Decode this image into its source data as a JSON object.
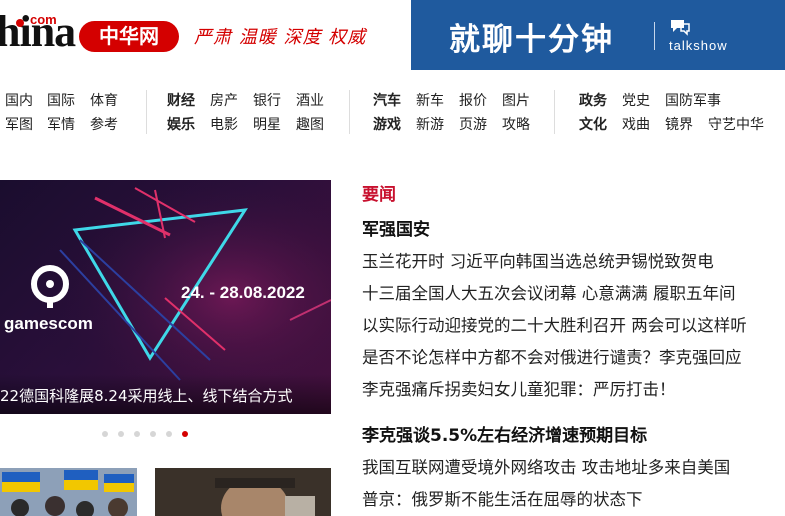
{
  "header": {
    "logo_text": "hina",
    "logo_com": "com",
    "logo_pill": "中华网",
    "slogan": "严肃 温暖 深度 权威",
    "banner_title": "就聊十分钟",
    "banner_sub": "talkshow"
  },
  "nav": {
    "g1_r1": [
      "国内",
      "国际",
      "体育"
    ],
    "g1_r2": [
      "军图",
      "军情",
      "参考"
    ],
    "g2_r1": [
      "财经",
      "房产",
      "银行",
      "酒业"
    ],
    "g2_r2": [
      "娱乐",
      "电影",
      "明星",
      "趣图"
    ],
    "g3_r1": [
      "汽车",
      "新车",
      "报价",
      "图片"
    ],
    "g3_r2": [
      "游戏",
      "新游",
      "页游",
      "攻略"
    ],
    "g4_r1": [
      "政务",
      "党史",
      "国防军事"
    ],
    "g4_r2": [
      "文化",
      "戏曲",
      "镜界",
      "守艺中华"
    ]
  },
  "carousel": {
    "dates": "24. - 28.08.2022",
    "brand": "gamescom",
    "caption": "22德国科隆展8.24采用线上、线下结合方式",
    "dot_count": 6,
    "active_dot": 6
  },
  "news": {
    "section_title": "要闻",
    "headline1": "军强国安",
    "lines1": [
      "玉兰花开时 习近平向韩国当选总统尹锡悦致贺电",
      "十三届全国人大五次会议闭幕 心意满满 履职五年间",
      "以实际行动迎接党的二十大胜利召开 两会可以这样听",
      "是否不论怎样中方都不会对俄进行谴责？李克强回应",
      "李克强痛斥拐卖妇女儿童犯罪：严厉打击！"
    ],
    "headline2": "李克强谈5.5%左右经济增速预期目标",
    "lines2": [
      "我国互联网遭受境外网络攻击 攻击地址多来自美国",
      "普京：俄罗斯不能生活在屈辱的状态下"
    ]
  },
  "colors": {
    "brand_red": "#d40000",
    "banner_blue": "#1f5a9e",
    "section_red": "#c8102e"
  }
}
